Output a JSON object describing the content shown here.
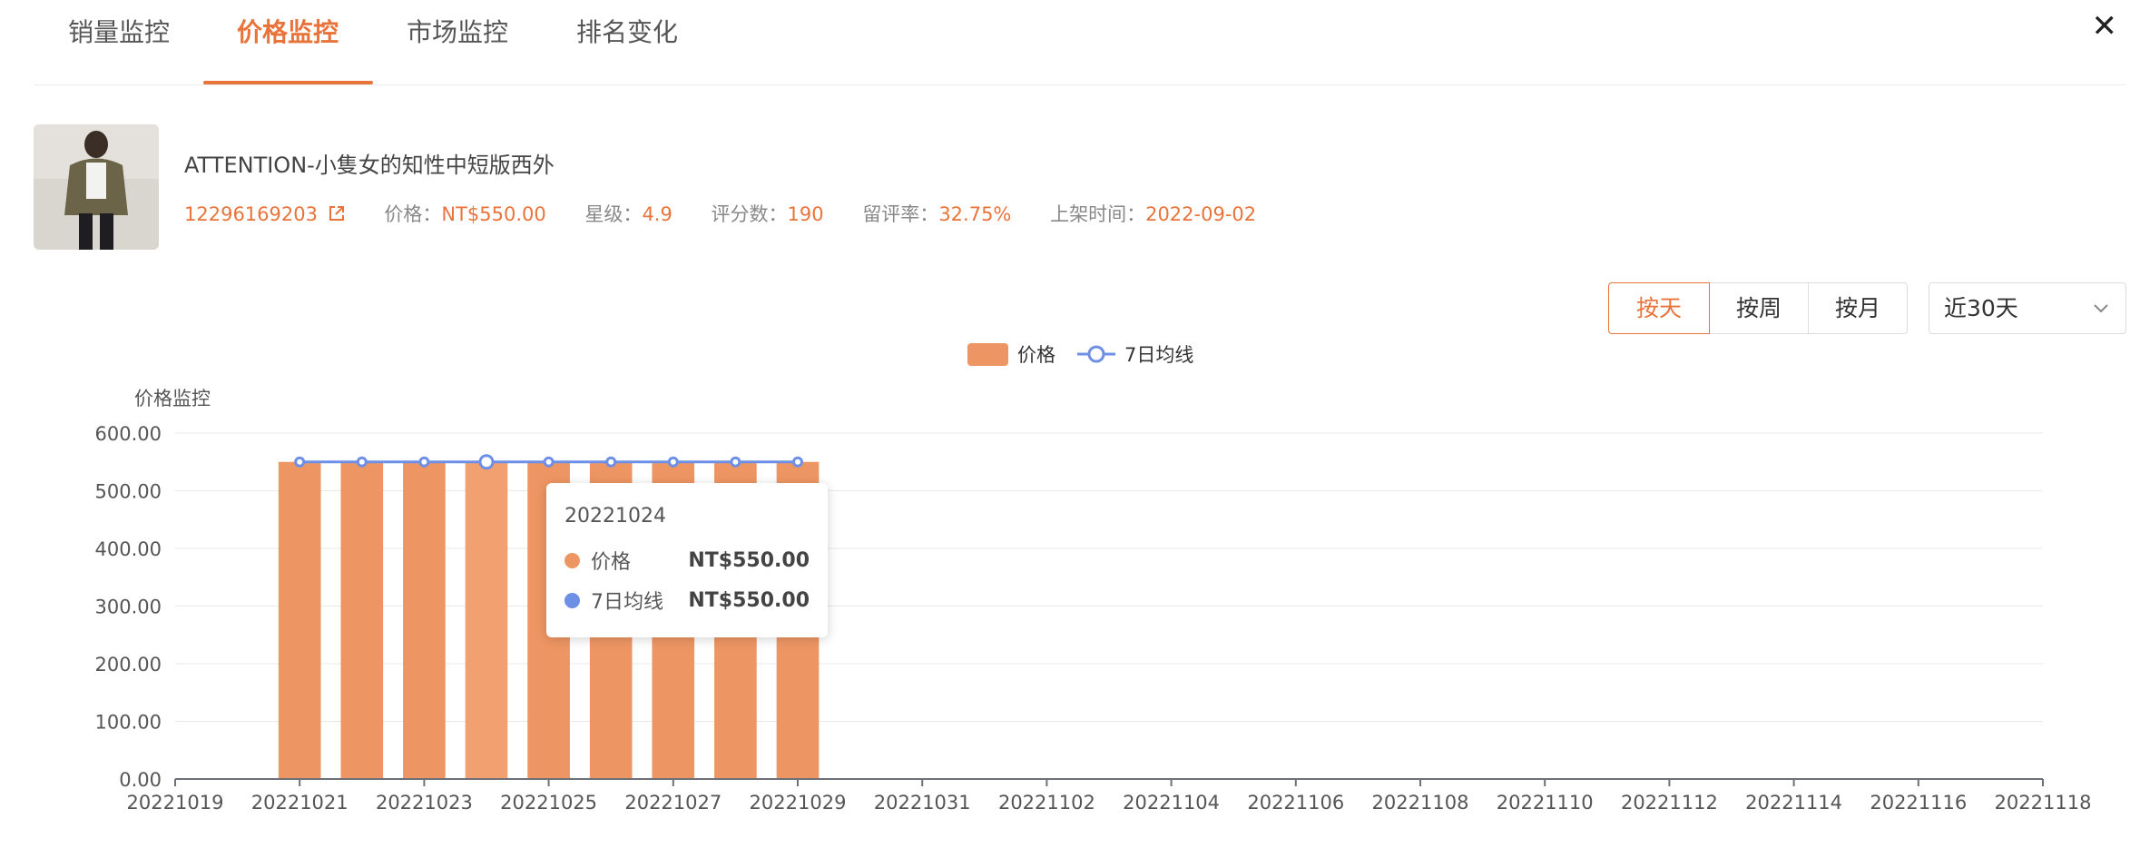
{
  "tabs": [
    {
      "label": "销量监控"
    },
    {
      "label": "价格监控"
    },
    {
      "label": "市场监控"
    },
    {
      "label": "排名变化"
    }
  ],
  "close_label": "✕",
  "product": {
    "title": "ATTENTION-小隻女的知性中短版西外",
    "id": "12296169203",
    "price_label": "价格：",
    "price": "NT$550.00",
    "stars_label": "星级：",
    "stars": "4.9",
    "reviews_label": "评分数：",
    "reviews": "190",
    "review_rate_label": "留评率：",
    "review_rate": "32.75%",
    "listed_label": "上架时间：",
    "listed": "2022-09-02"
  },
  "controls": {
    "granularity": [
      {
        "label": "按天"
      },
      {
        "label": "按周"
      },
      {
        "label": "按月"
      }
    ],
    "range": "近30天"
  },
  "colors": {
    "accent": "#e8743b",
    "bar": "#ee9663",
    "line": "#6e8fe6"
  },
  "tooltip": {
    "date": "20221024",
    "rows": [
      {
        "name": "价格",
        "value": "NT$550.00"
      },
      {
        "name": "7日均线",
        "value": "NT$550.00"
      }
    ]
  },
  "chart_data": {
    "type": "bar",
    "ylabel": "价格监控",
    "ylim": [
      0,
      600
    ],
    "yticks": [
      "0.00",
      "100.00",
      "200.00",
      "300.00",
      "400.00",
      "500.00",
      "600.00"
    ],
    "xticks": [
      "20221019",
      "20221021",
      "20221023",
      "20221025",
      "20221027",
      "20221029",
      "20221031",
      "20221102",
      "20221104",
      "20221106",
      "20221108",
      "20221110",
      "20221112",
      "20221114",
      "20221116",
      "20221118"
    ],
    "grid": true,
    "legend_position": "top-center",
    "series": [
      {
        "name": "价格",
        "type": "bar",
        "x": [
          "20221021",
          "20221022",
          "20221023",
          "20221024",
          "20221025",
          "20221026",
          "20221027",
          "20221028",
          "20221029"
        ],
        "values": [
          550,
          550,
          550,
          550,
          550,
          550,
          550,
          550,
          550
        ]
      },
      {
        "name": "7日均线",
        "type": "line",
        "x": [
          "20221021",
          "20221022",
          "20221023",
          "20221024",
          "20221025",
          "20221026",
          "20221027",
          "20221028",
          "20221029"
        ],
        "values": [
          550,
          550,
          550,
          550,
          550,
          550,
          550,
          550,
          550
        ]
      }
    ]
  }
}
